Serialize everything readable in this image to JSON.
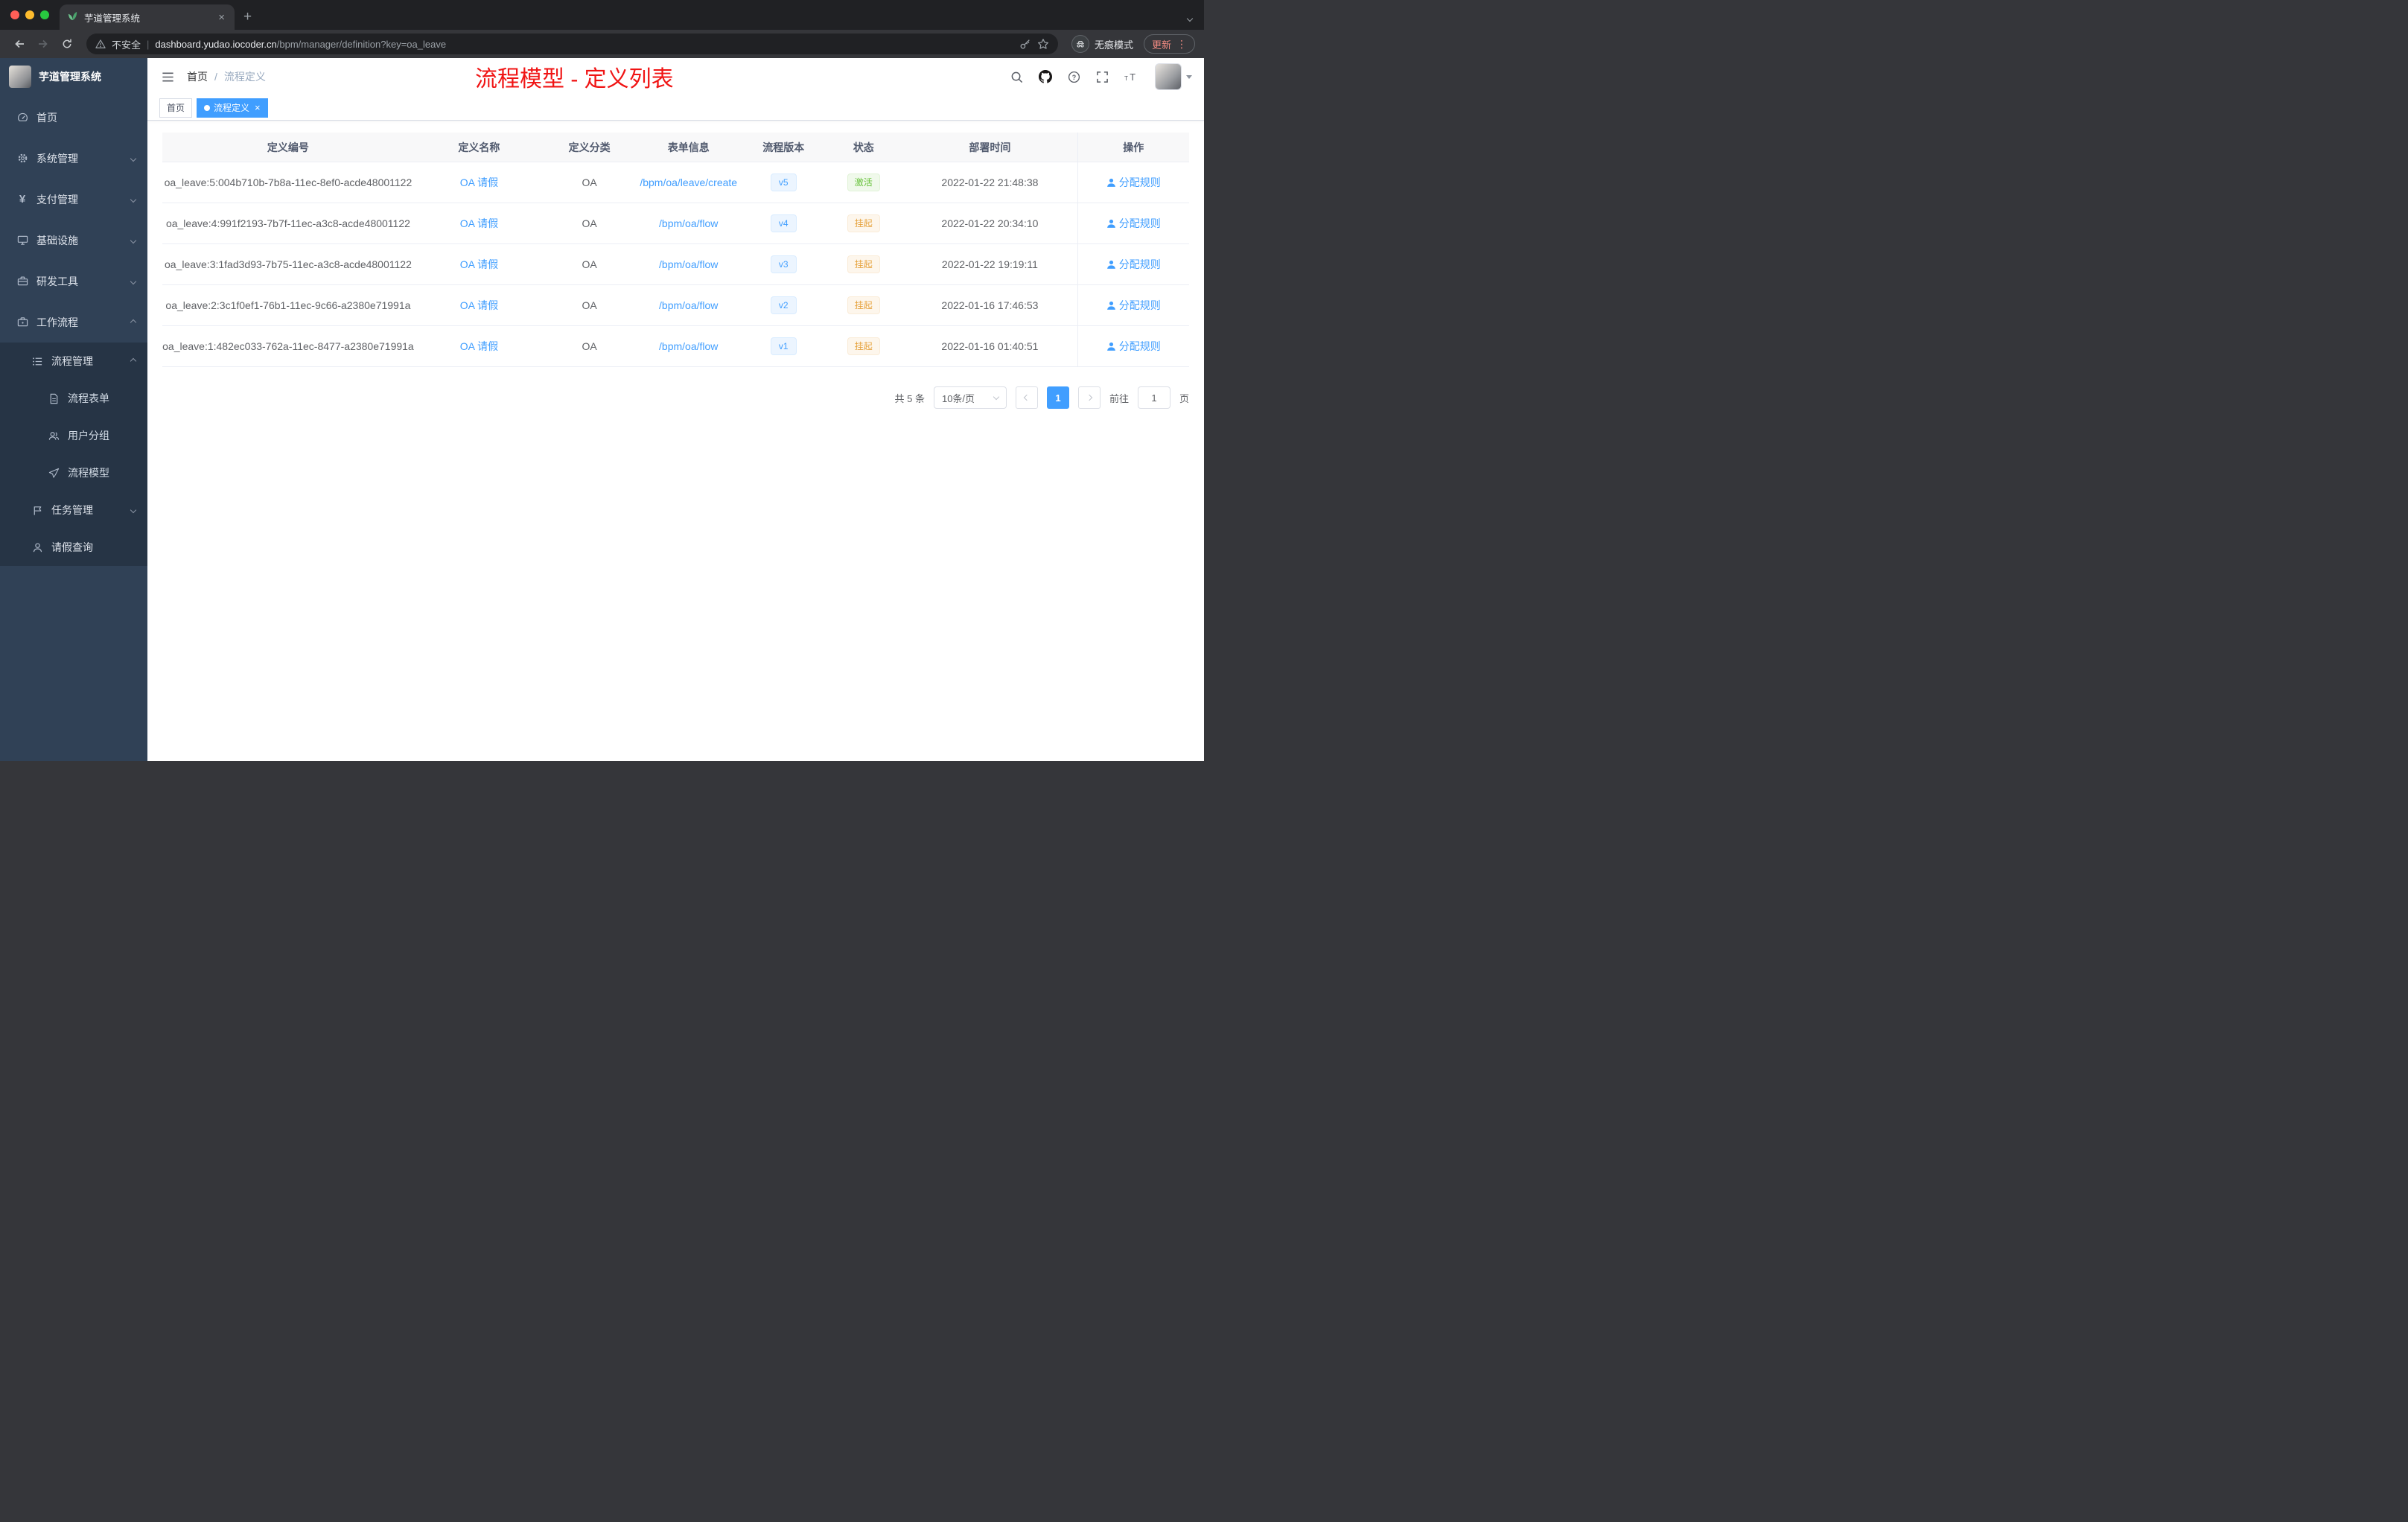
{
  "colors": {
    "accent": "#409eff",
    "success": "#67c23a",
    "warning": "#e6a23c",
    "annotation_red": "#f01414",
    "sidebar_bg": "#304156",
    "submenu_bg": "#263445"
  },
  "browser": {
    "tab_title": "芋道管理系统",
    "security_label": "不安全",
    "url_host": "dashboard.yudao.iocoder.cn",
    "url_path": "/bpm/manager/definition?key=oa_leave",
    "incognito_label": "无痕模式",
    "update_label": "更新"
  },
  "sidebar": {
    "logo_title": "芋道管理系统",
    "menu": [
      {
        "label": "首页"
      },
      {
        "label": "系统管理"
      },
      {
        "label": "支付管理"
      },
      {
        "label": "基础设施"
      },
      {
        "label": "研发工具"
      },
      {
        "label": "工作流程"
      },
      {
        "label": "流程管理"
      },
      {
        "label": "流程表单"
      },
      {
        "label": "用户分组"
      },
      {
        "label": "流程模型"
      },
      {
        "label": "任务管理"
      },
      {
        "label": "请假查询"
      }
    ]
  },
  "navbar": {
    "breadcrumb_home": "首页",
    "breadcrumb_sep": "/",
    "breadcrumb_current": "流程定义",
    "annotation": "流程模型 - 定义列表"
  },
  "tags": {
    "home": "首页",
    "current": "流程定义"
  },
  "table": {
    "columns": [
      "定义编号",
      "定义名称",
      "定义分类",
      "表单信息",
      "流程版本",
      "状态",
      "部署时间",
      "操作"
    ],
    "rows": [
      {
        "id": "oa_leave:5:004b710b-7b8a-11ec-8ef0-acde48001122",
        "name": "OA 请假",
        "category": "OA",
        "form": "/bpm/oa/leave/create",
        "version": "v5",
        "status": "激活",
        "status_type": "success",
        "deploy_time": "2022-01-22 21:48:38",
        "action": "分配规则"
      },
      {
        "id": "oa_leave:4:991f2193-7b7f-11ec-a3c8-acde48001122",
        "name": "OA 请假",
        "category": "OA",
        "form": "/bpm/oa/flow",
        "version": "v4",
        "status": "挂起",
        "status_type": "warning",
        "deploy_time": "2022-01-22 20:34:10",
        "action": "分配规则"
      },
      {
        "id": "oa_leave:3:1fad3d93-7b75-11ec-a3c8-acde48001122",
        "name": "OA 请假",
        "category": "OA",
        "form": "/bpm/oa/flow",
        "version": "v3",
        "status": "挂起",
        "status_type": "warning",
        "deploy_time": "2022-01-22 19:19:11",
        "action": "分配规则"
      },
      {
        "id": "oa_leave:2:3c1f0ef1-76b1-11ec-9c66-a2380e71991a",
        "name": "OA 请假",
        "category": "OA",
        "form": "/bpm/oa/flow",
        "version": "v2",
        "status": "挂起",
        "status_type": "warning",
        "deploy_time": "2022-01-16 17:46:53",
        "action": "分配规则"
      },
      {
        "id": "oa_leave:1:482ec033-762a-11ec-8477-a2380e71991a",
        "name": "OA 请假",
        "category": "OA",
        "form": "/bpm/oa/flow",
        "version": "v1",
        "status": "挂起",
        "status_type": "warning",
        "deploy_time": "2022-01-16 01:40:51",
        "action": "分配规则"
      }
    ]
  },
  "pagination": {
    "total": "共 5 条",
    "page_size": "10条/页",
    "page": "1",
    "goto_prefix": "前往",
    "goto_value": "1",
    "goto_suffix": "页"
  }
}
